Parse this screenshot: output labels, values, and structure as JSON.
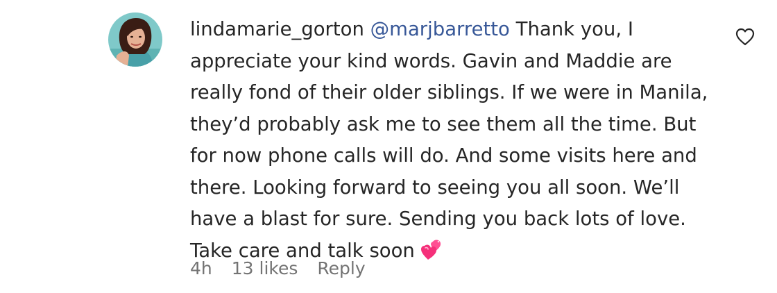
{
  "comment": {
    "username": "lindamarie_gorton",
    "mention": "@marjbarretto",
    "text": "Thank you, I appreciate your kind words. Gavin and Maddie are really fond of their older siblings. If we were in Manila, they’d probably ask me to see them all the time. But for now phone calls will do. And some visits here and there. Looking forward to seeing you all soon. We’ll have a blast for sure. Sending you back lots of love. Take care and talk soon",
    "emoji": "two-hearts-icon",
    "time": "4h",
    "likes": "13 likes",
    "reply_label": "Reply"
  },
  "colors": {
    "mention": "#385898",
    "meta": "#737373",
    "text": "#262626",
    "emoji": "#f5307a"
  }
}
